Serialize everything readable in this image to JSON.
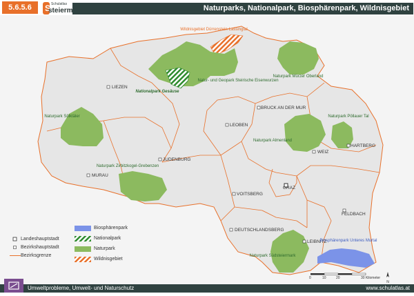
{
  "header": {
    "section": "5.6.5.6",
    "logo_small": "Schulatlas",
    "logo_text": "steiermark",
    "title": "Naturparks, Nationalpark, Biosphärenpark, Wildnisgebiet"
  },
  "map": {
    "districts": [
      "LIEZEN",
      "MURAU",
      "JUDENBURG",
      "LEOBEN",
      "BRUCK AN DER MUR",
      "WEIZ",
      "HARTBERG",
      "GRAZ",
      "VOITSBERG",
      "DEUTSCHLANDSBERG",
      "LEIBNITZ",
      "FELDBACH"
    ],
    "park_labels": {
      "wildnis": "Wildnisgebiet Dürrenstein-Lassingtal",
      "nationalpark": "Nationalpark Gesäuse",
      "eisenwurzen": "Natur- und Geopark Steirische Eisenwurzen",
      "muerzer": "Naturpark Mürzer Oberland",
      "soelktaeler": "Naturpark Sölktäler",
      "poellauer": "Naturpark Pöllauer Tal",
      "almenland": "Naturpark Almenland",
      "zirbitz": "Naturpark Zirbitzkogel-Grebenzen",
      "suedsteiermark": "Naturpark Südsteiermark",
      "biosphaere": "Biosphärenpark Unteres Murtal"
    },
    "scale": {
      "ticks": [
        "0",
        "10",
        "20",
        "30 Kilometer"
      ]
    }
  },
  "legend": {
    "left": [
      "Landeshauptstadt",
      "Bezirkshauptstadt",
      "Bezirksgrenze"
    ],
    "right": [
      "Biosphärenpark",
      "Nationalpark",
      "Naturpark",
      "Wildnisgebiet"
    ]
  },
  "colors": {
    "naturpark": "#8cba5f",
    "biosphaere": "#7b93e8",
    "national": "#2e8b2e",
    "wildnis": "#e8702a",
    "border": "#e8702a",
    "header": "#2f4240"
  },
  "footer": {
    "title": "Umweltprobleme, Umwelt- und Naturschutz",
    "url": "www.schulatlas.at"
  }
}
